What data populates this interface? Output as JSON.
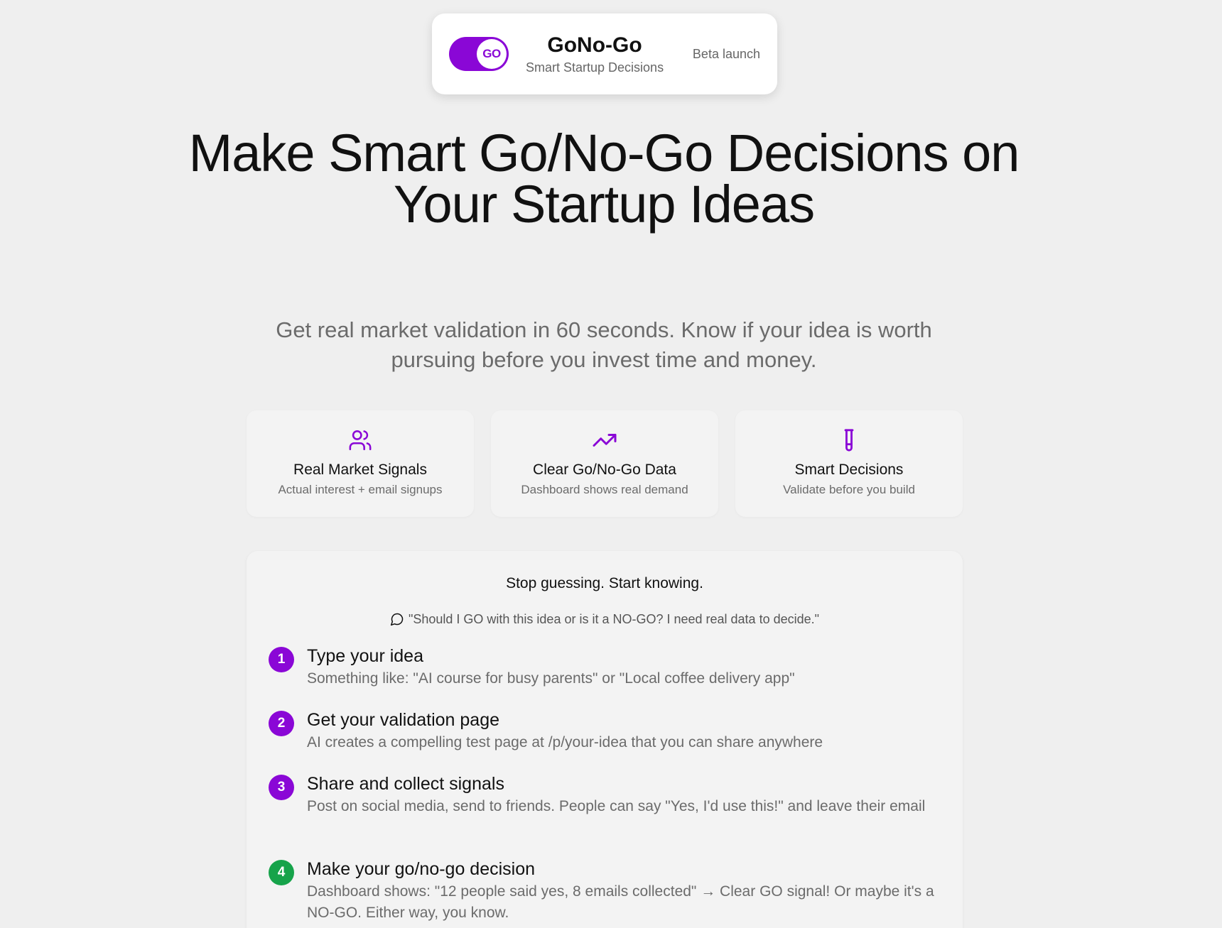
{
  "brand": {
    "toggle_label": "GO",
    "name": "GoNo-Go",
    "tagline": "Smart Startup Decisions",
    "badge": "Beta launch",
    "accent_color": "#8a07d6"
  },
  "hero": {
    "title": "Make Smart Go/No-Go Decisions on Your Startup Ideas",
    "subtitle": "Get real market validation in 60 seconds. Know if your idea is worth pursuing before you invest time and money."
  },
  "features": [
    {
      "icon": "users-icon",
      "title": "Real Market Signals",
      "desc": "Actual interest + email signups"
    },
    {
      "icon": "trending-up-icon",
      "title": "Clear Go/No-Go Data",
      "desc": "Dashboard shows real demand"
    },
    {
      "icon": "test-tube-icon",
      "title": "Smart Decisions",
      "desc": "Validate before you build"
    }
  ],
  "how": {
    "heading": "Stop guessing. Start knowing.",
    "quote": "\"Should I GO with this idea or is it a NO-GO? I need real data to decide.\"",
    "steps": [
      {
        "num": "1",
        "title": "Type your idea",
        "desc": "Something like: \"AI course for busy parents\" or \"Local coffee delivery app\"",
        "color": "#8a07d6"
      },
      {
        "num": "2",
        "title": "Get your validation page",
        "desc": "AI creates a compelling test page at /p/your-idea that you can share anywhere",
        "color": "#8a07d6"
      },
      {
        "num": "3",
        "title": "Share and collect signals",
        "desc": "Post on social media, send to friends. People can say \"Yes, I'd use this!\" and leave their email",
        "color": "#8a07d6"
      },
      {
        "num": "4",
        "title": "Make your go/no-go decision",
        "desc": "Dashboard shows: \"12 people said yes, 8 emails collected\" → Clear GO signal! Or maybe it's a NO-GO. Either way, you know.",
        "color": "#16a34a"
      }
    ]
  }
}
